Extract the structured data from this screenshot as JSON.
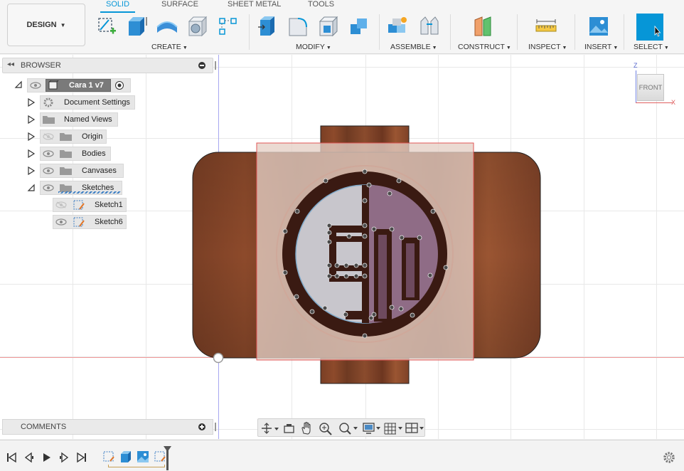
{
  "toolbar": {
    "design_label": "DESIGN",
    "tabs": [
      "SOLID",
      "SURFACE",
      "SHEET METAL",
      "TOOLS"
    ],
    "groups": {
      "create": "CREATE",
      "modify": "MODIFY",
      "assemble": "ASSEMBLE",
      "construct": "CONSTRUCT",
      "inspect": "INSPECT",
      "insert": "INSERT",
      "select": "SELECT"
    }
  },
  "browser": {
    "title": "BROWSER",
    "root": "Cara 1 v7",
    "items": [
      {
        "label": "Document Settings"
      },
      {
        "label": "Named Views"
      },
      {
        "label": "Origin"
      },
      {
        "label": "Bodies"
      },
      {
        "label": "Canvases"
      },
      {
        "label": "Sketches"
      }
    ],
    "sketches": [
      {
        "label": "Sketch1"
      },
      {
        "label": "Sketch6"
      }
    ]
  },
  "viewcube": {
    "face": "FRONT",
    "axis_z": "Z",
    "axis_x": "X"
  },
  "comments": {
    "title": "COMMENTS"
  },
  "colors": {
    "accent": "#0696d7",
    "wood": "#8a4a2e",
    "select_blue": "#0696d7"
  }
}
